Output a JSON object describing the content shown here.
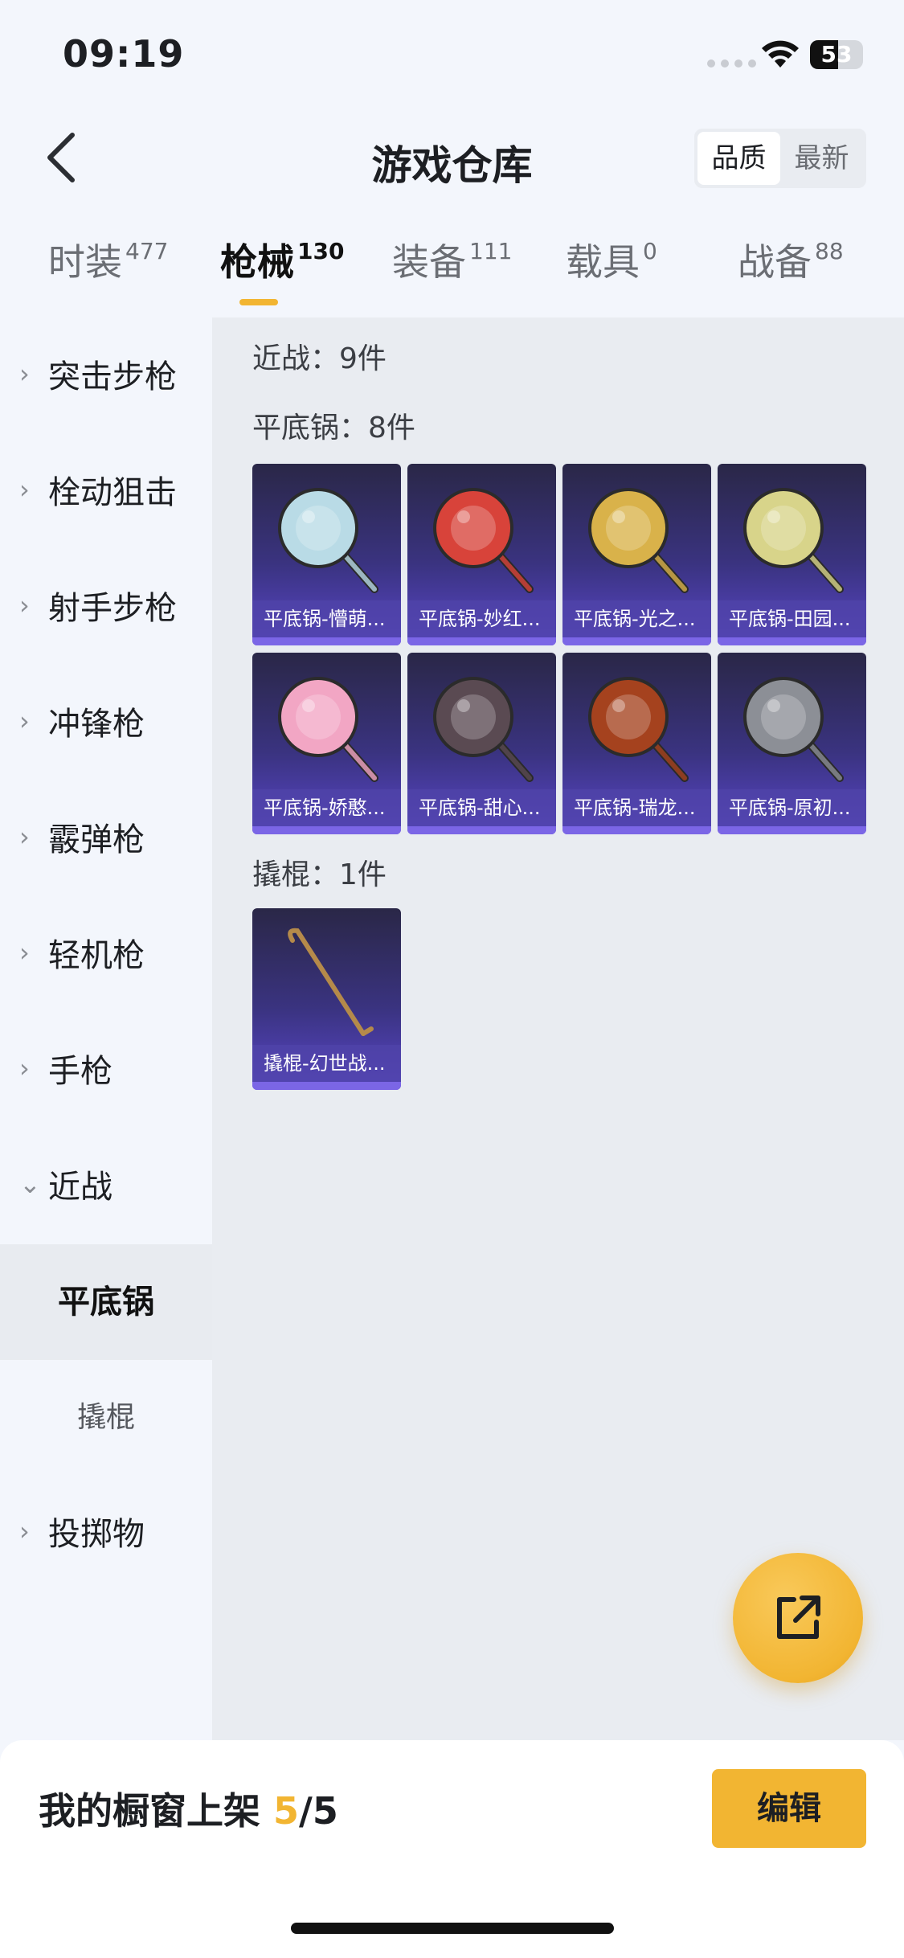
{
  "status": {
    "time": "09:19",
    "battery": "53"
  },
  "header": {
    "title": "游戏仓库",
    "sort_options": [
      "品质",
      "最新"
    ],
    "sort_active": 0
  },
  "tabs": [
    {
      "label": "时装",
      "count": "477"
    },
    {
      "label": "枪械",
      "count": "130"
    },
    {
      "label": "装备",
      "count": "111"
    },
    {
      "label": "载具",
      "count": "0"
    },
    {
      "label": "战备",
      "count": "88"
    }
  ],
  "active_tab": 1,
  "sidebar": {
    "items": [
      {
        "label": "突击步枪",
        "chevron": "›"
      },
      {
        "label": "栓动狙击",
        "chevron": "›"
      },
      {
        "label": "射手步枪",
        "chevron": "›"
      },
      {
        "label": "冲锋枪",
        "chevron": "›"
      },
      {
        "label": "霰弹枪",
        "chevron": "›"
      },
      {
        "label": "轻机枪",
        "chevron": "›"
      },
      {
        "label": "手枪",
        "chevron": "›"
      },
      {
        "label": "近战",
        "chevron": "⌄"
      }
    ],
    "subitems": [
      {
        "label": "平底锅",
        "active": true
      },
      {
        "label": "撬棍",
        "active": false
      }
    ],
    "last_item": {
      "label": "投掷物",
      "chevron": "›"
    }
  },
  "content": {
    "melee_summary": "近战：9件",
    "pan_section": "平底锅：8件",
    "pan_items": [
      {
        "name": "平底锅-懵萌...",
        "color": "#b9dbe6"
      },
      {
        "name": "平底锅-妙红...",
        "color": "#d8433a"
      },
      {
        "name": "平底锅-光之...",
        "color": "#d9b24a"
      },
      {
        "name": "平底锅-田园...",
        "color": "#d8d48a"
      },
      {
        "name": "平底锅-娇憨...",
        "color": "#f2a6c4"
      },
      {
        "name": "平底锅-甜心...",
        "color": "#5a4a52"
      },
      {
        "name": "平底锅-瑞龙...",
        "color": "#a5421e"
      },
      {
        "name": "平底锅-原初...",
        "color": "#8c8f96"
      }
    ],
    "crowbar_section": "撬棍：1件",
    "crowbar_items": [
      {
        "name": "撬棍-幻世战...",
        "color": "#b58a4a"
      }
    ]
  },
  "fab": {
    "icon": "share-icon"
  },
  "bottom": {
    "shelf_label": "我的橱窗上架",
    "shelf_current": "5",
    "shelf_total": "/5",
    "edit_label": "编辑"
  }
}
